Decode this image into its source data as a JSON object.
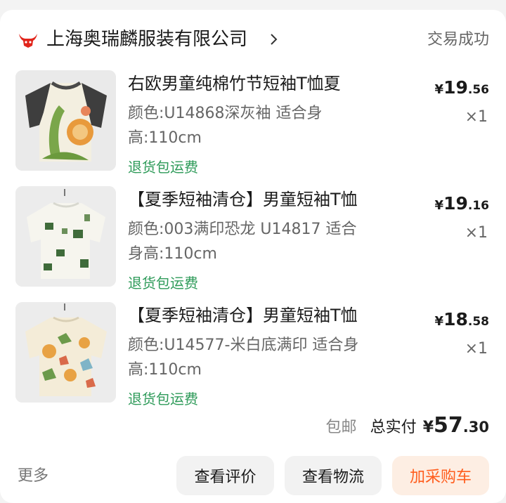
{
  "shop": {
    "name": "上海奥瑞麟服装有限公司",
    "status": "交易成功",
    "logo_icon": "red-bull-logo-icon",
    "chevron_icon": "chevron-right-icon"
  },
  "items": [
    {
      "title": "右欧男童纯棉竹节短袖T恤夏",
      "spec_line1": "颜色:U14868深灰袖 适合身",
      "spec_line2": "高:110cm",
      "tag": "退货包运费",
      "price_currency": "¥",
      "price_int": "19",
      "price_dec": ".56",
      "qty": "×1"
    },
    {
      "title": "【夏季短袖清仓】男童短袖T恤",
      "spec_line1": "颜色:003满印恐龙 U14817 适合",
      "spec_line2": "身高:110cm",
      "tag": "退货包运费",
      "price_currency": "¥",
      "price_int": "19",
      "price_dec": ".16",
      "qty": "×1"
    },
    {
      "title": "【夏季短袖清仓】男童短袖T恤",
      "spec_line1": "颜色:U14577-米白底满印 适合身",
      "spec_line2": "高:110cm",
      "tag": "退货包运费",
      "price_currency": "¥",
      "price_int": "18",
      "price_dec": ".58",
      "qty": "×1"
    }
  ],
  "summary": {
    "shipping": "包邮",
    "total_label": "总实付",
    "total_currency": "¥",
    "total_int": "57",
    "total_dec": ".30"
  },
  "actions": {
    "more": "更多",
    "review": "查看评价",
    "logistics": "查看物流",
    "add_to_cart": "加采购车"
  },
  "colors": {
    "tag_green": "#2f9b5a",
    "cart_orange": "#ff5d1d",
    "cart_bg": "#fdeee3",
    "logo_red": "#e1251b"
  }
}
